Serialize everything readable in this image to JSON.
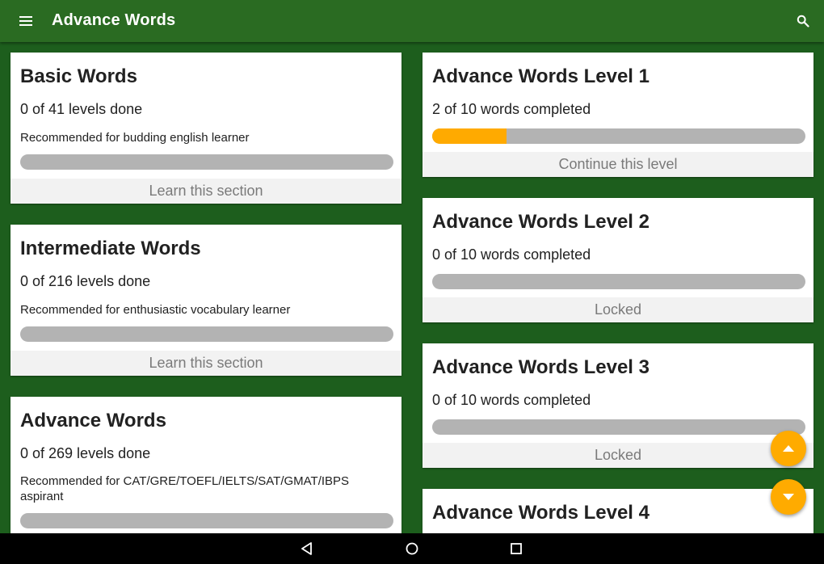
{
  "app": {
    "title": "Advance Words"
  },
  "sections": [
    {
      "title": "Basic Words",
      "progress_text": "0 of 41 levels done",
      "description": "Recommended for budding english learner",
      "progress": 0,
      "action": "Learn this section"
    },
    {
      "title": "Intermediate Words",
      "progress_text": "0 of 216 levels done",
      "description": "Recommended for enthusiastic vocabulary learner",
      "progress": 0,
      "action": "Learn this section"
    },
    {
      "title": "Advance Words",
      "progress_text": "0 of 269 levels done",
      "description": "Recommended for CAT/GRE/TOEFL/IELTS/SAT/GMAT/IBPS aspirant",
      "progress": 0
    }
  ],
  "levels": [
    {
      "title": "Advance Words Level 1",
      "progress_text": "2 of 10 words completed",
      "progress": 0.2,
      "action": "Continue this level"
    },
    {
      "title": "Advance Words Level 2",
      "progress_text": "0 of 10 words completed",
      "progress": 0,
      "action": "Locked"
    },
    {
      "title": "Advance Words Level 3",
      "progress_text": "0 of 10 words completed",
      "progress": 0,
      "action": "Locked"
    },
    {
      "title": "Advance Words Level 4"
    }
  ],
  "icons": {
    "menu": "menu-icon",
    "search": "search-icon",
    "scroll_up": "chevron-up-icon",
    "scroll_down": "chevron-down-icon",
    "back": "back-icon",
    "home": "home-icon",
    "recents": "recents-icon"
  },
  "colors": {
    "app_bar": "#2a6b22",
    "background": "#1d5e1d",
    "accent": "#ffab00",
    "progress_track": "#b3b3b3"
  }
}
